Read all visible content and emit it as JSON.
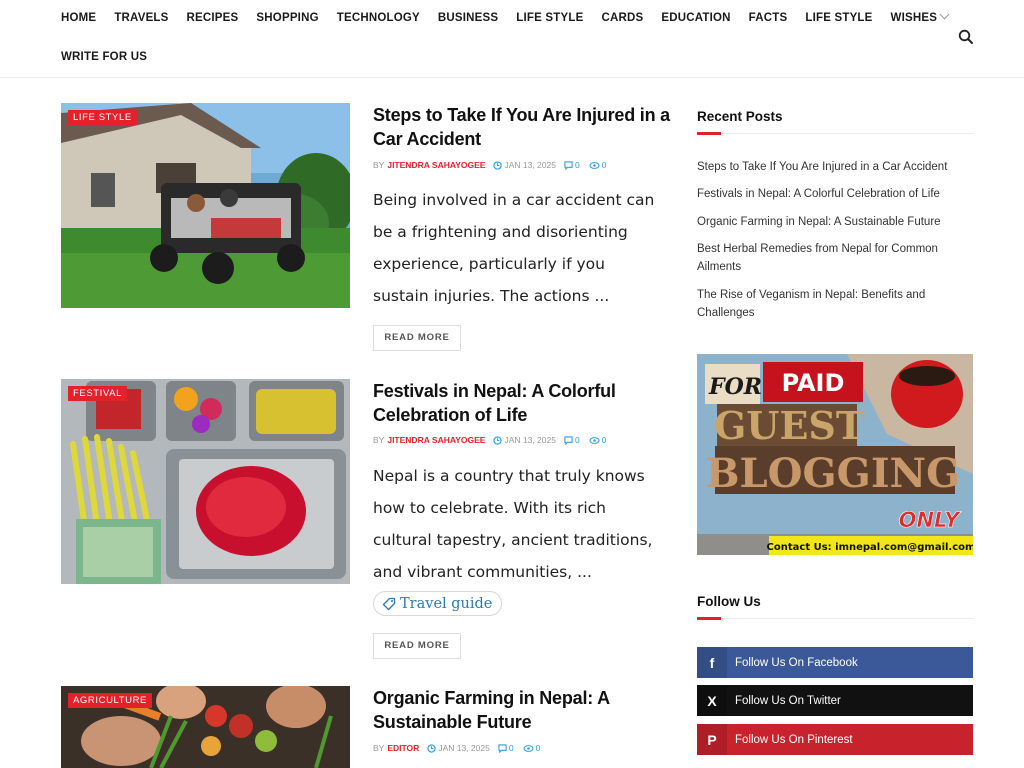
{
  "nav": {
    "items": [
      "HOME",
      "TRAVELS",
      "RECIPES",
      "SHOPPING",
      "TECHNOLOGY",
      "BUSINESS",
      "LIFE STYLE",
      "CARDS",
      "EDUCATION",
      "FACTS",
      "LIFE STYLE",
      "WISHES"
    ],
    "row2": [
      "WRITE FOR US"
    ],
    "search_icon": "search-icon"
  },
  "posts": [
    {
      "category": "LIFE STYLE",
      "title": "Steps to Take If You Are Injured in a Car Accident",
      "by": "BY",
      "author": "JITENDRA SAHAYOGEE",
      "date": "JAN 13, 2025",
      "comments": "0",
      "views": "0",
      "excerpt": "Being involved in a car accident can be a frightening and disorienting experience, particularly if you sustain injuries. The actions ...",
      "read_more": "READ MORE"
    },
    {
      "category": "FESTIVAL",
      "title": "Festivals in Nepal: A Colorful Celebration of Life",
      "by": "BY",
      "author": "JITENDRA SAHAYOGEE",
      "date": "JAN 13, 2025",
      "comments": "0",
      "views": "0",
      "excerpt": "Nepal is a country that truly knows how to celebrate. With its rich cultural tapestry, ancient traditions, and vibrant communities, ...",
      "tag": "Travel guide",
      "read_more": "READ MORE"
    },
    {
      "category": "AGRICULTURE",
      "title": "Organic Farming in Nepal: A Sustainable Future",
      "by": "BY",
      "author": "EDITOR",
      "date": "JAN 13, 2025",
      "comments": "0",
      "views": "0"
    }
  ],
  "sidebar": {
    "recent_heading": "Recent Posts",
    "recent": [
      "Steps to Take If You Are Injured in a Car Accident",
      "Festivals in Nepal: A Colorful Celebration of Life",
      "Organic Farming in Nepal: A Sustainable Future",
      "Best Herbal Remedies from Nepal for Common Ailments",
      "The Rise of Veganism in Nepal: Benefits and Challenges"
    ],
    "ad": {
      "for": "FOR",
      "paid": "PAID",
      "guest": "GUEST",
      "blogging": "BLOGGING",
      "only": "ONLY",
      "contact": "Contact Us: imnepal.com@gmail.com"
    },
    "follow_heading": "Follow Us",
    "social": [
      {
        "label": "Follow Us On Facebook",
        "icon": "facebook-icon",
        "glyph": "f",
        "color": "#3b5998"
      },
      {
        "label": "Follow Us On Twitter",
        "icon": "x-twitter-icon",
        "glyph": "X",
        "color": "#111111"
      },
      {
        "label": "Follow Us On Pinterest",
        "icon": "pinterest-icon",
        "glyph": "P",
        "color": "#c8232c"
      }
    ]
  },
  "colors": {
    "accent": "#e2212b",
    "link_blue": "#2e9fe0"
  }
}
